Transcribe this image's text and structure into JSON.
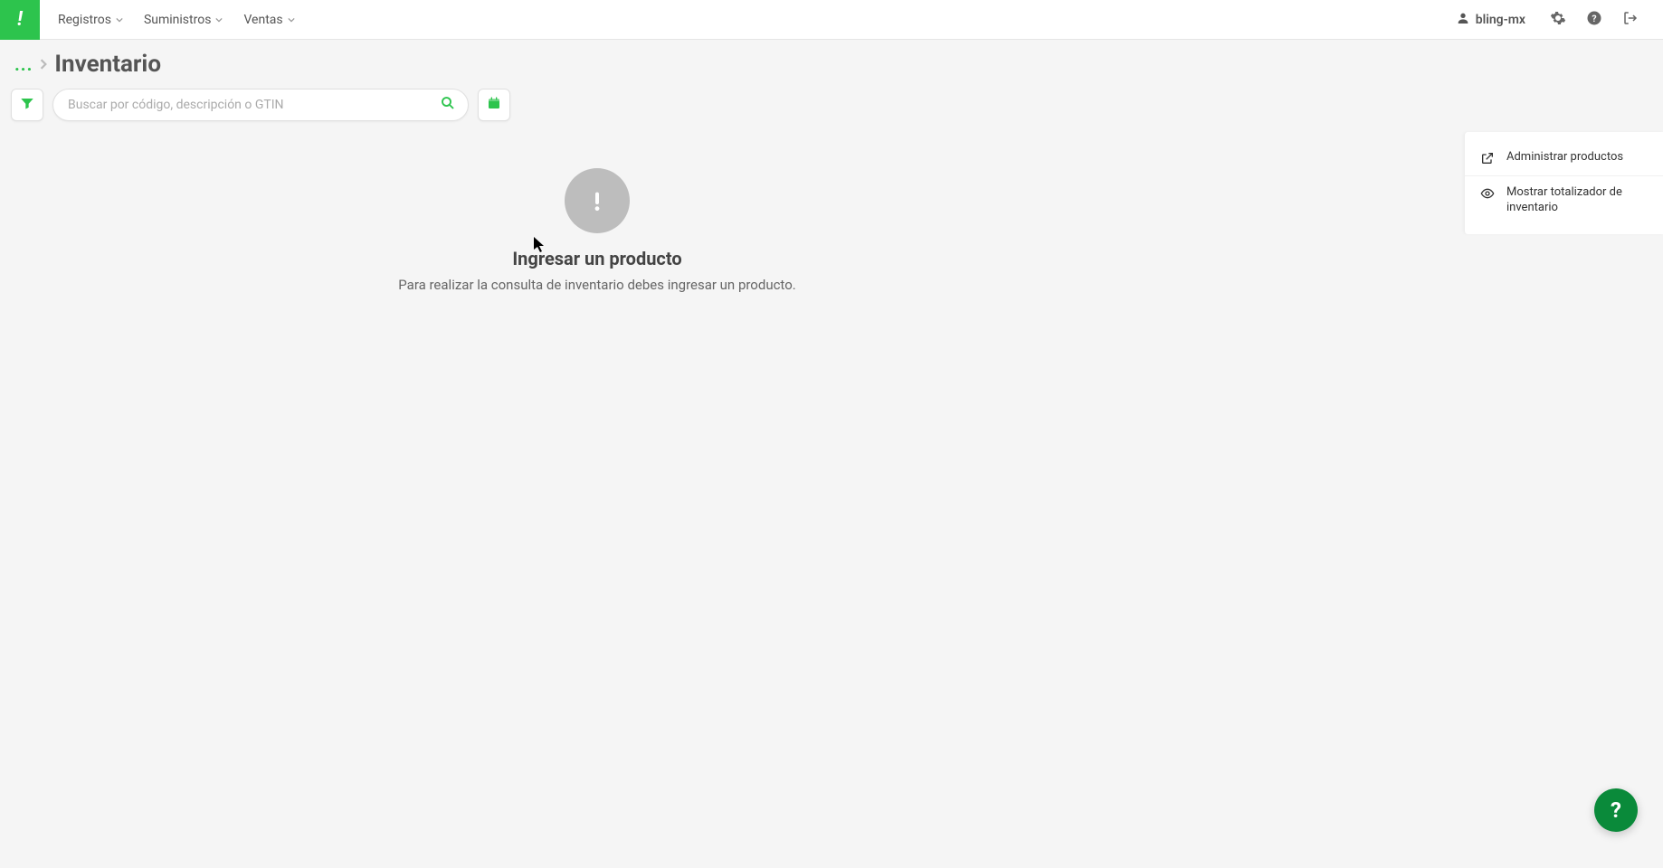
{
  "nav": {
    "items": [
      {
        "label": "Registros"
      },
      {
        "label": "Suministros"
      },
      {
        "label": "Ventas"
      }
    ],
    "user": "bling-mx"
  },
  "breadcrumb": {
    "dots": "...",
    "title": "Inventario"
  },
  "toolbar": {
    "search_placeholder": "Buscar por código, descripción o GTIN"
  },
  "empty": {
    "title": "Ingresar un producto",
    "subtitle": "Para realizar la consulta de inventario debes ingresar un producto."
  },
  "sidebar": {
    "items": [
      {
        "label": "Administrar productos"
      },
      {
        "label": "Mostrar totalizador de inventario"
      }
    ]
  },
  "help_fab": "?"
}
